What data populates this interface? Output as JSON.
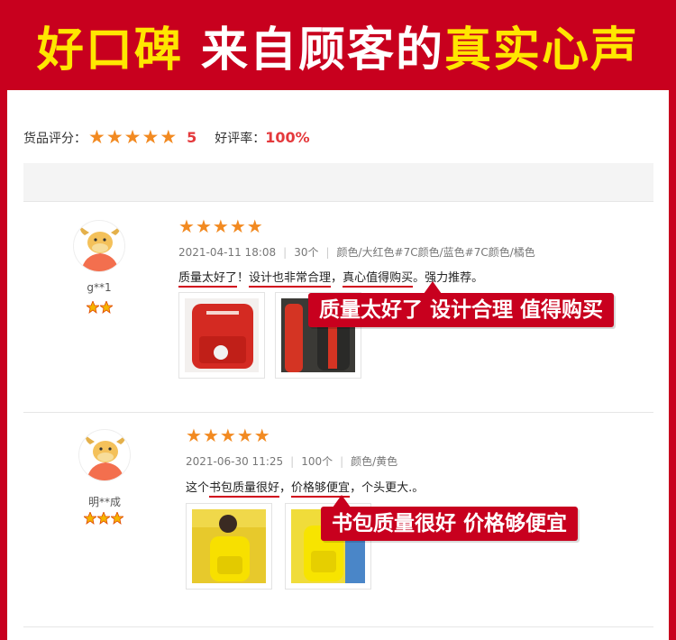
{
  "banner": {
    "part1": "好口碑",
    "part2": " 来自顾客的",
    "part3": "真实心声"
  },
  "summary": {
    "score_label": "货品评分：",
    "score": "5",
    "rate_label": "好评率：",
    "rate": "100%"
  },
  "reviews": [
    {
      "user": "g**1",
      "date": "2021-04-11 18:08",
      "quantity": "30个",
      "variant": "颜色/大红色#7C颜色/蓝色#7C颜色/橘色",
      "comment_parts": [
        "质量太好了",
        "！",
        "设计也非常合理",
        "，",
        "真心值得购买",
        "。强力推荐。"
      ],
      "callout": "质量太好了 设计合理 值得购买"
    },
    {
      "user": "明**成",
      "date": "2021-06-30 11:25",
      "quantity": "100个",
      "variant": "颜色/黄色",
      "comment_parts": [
        "这个",
        "书包质量很好",
        "，",
        "价格够便宜",
        "，个头更大.。"
      ],
      "callout": "书包质量很好 价格够便宜"
    }
  ],
  "colors": {
    "brand_red": "#c8001e",
    "banner_yellow": "#ffe600",
    "star_orange": "#f28a21",
    "price_red": "#e4393c"
  }
}
